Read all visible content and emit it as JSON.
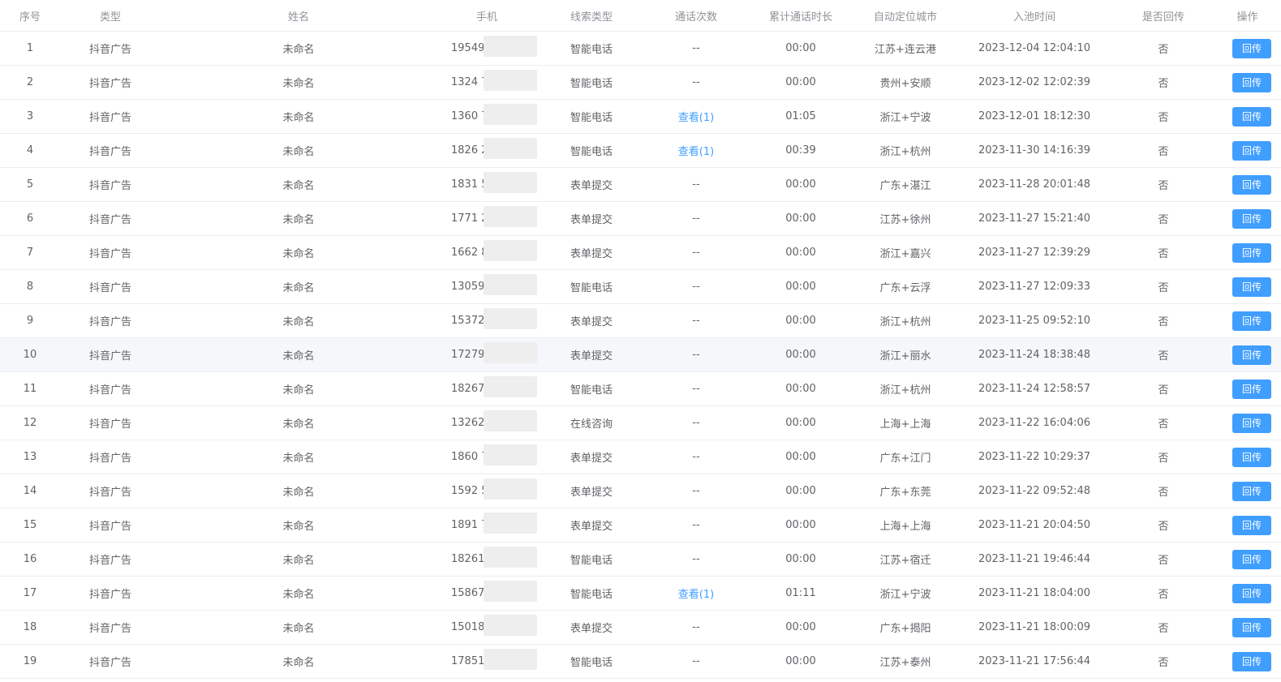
{
  "headers": {
    "seq": "序号",
    "type": "类型",
    "name": "姓名",
    "phone": "手机",
    "lead_type": "线索类型",
    "calls": "通话次数",
    "duration": "累计通话时长",
    "city": "自动定位城市",
    "time": "入池时间",
    "callback": "是否回传",
    "action": "操作"
  },
  "rows": [
    {
      "seq": "1",
      "type": "抖音广告",
      "name": "未命名",
      "phone": "19549",
      "lead_type": "智能电话",
      "calls": "--",
      "calls_link": false,
      "duration": "00:00",
      "city": "江苏+连云港",
      "time": "2023-12-04 12:04:10",
      "callback": "否",
      "action": "回传"
    },
    {
      "seq": "2",
      "type": "抖音广告",
      "name": "未命名",
      "phone": "1324          7",
      "lead_type": "智能电话",
      "calls": "--",
      "calls_link": false,
      "duration": "00:00",
      "city": "贵州+安顺",
      "time": "2023-12-02 12:02:39",
      "callback": "否",
      "action": "回传"
    },
    {
      "seq": "3",
      "type": "抖音广告",
      "name": "未命名",
      "phone": "1360          77",
      "lead_type": "智能电话",
      "calls": "查看(1)",
      "calls_link": true,
      "duration": "01:05",
      "city": "浙江+宁波",
      "time": "2023-12-01 18:12:30",
      "callback": "否",
      "action": "回传"
    },
    {
      "seq": "4",
      "type": "抖音广告",
      "name": "未命名",
      "phone": "1826          22",
      "lead_type": "智能电话",
      "calls": "查看(1)",
      "calls_link": true,
      "duration": "00:39",
      "city": "浙江+杭州",
      "time": "2023-11-30 14:16:39",
      "callback": "否",
      "action": "回传"
    },
    {
      "seq": "5",
      "type": "抖音广告",
      "name": "未命名",
      "phone": "1831          58",
      "lead_type": "表单提交",
      "calls": "--",
      "calls_link": false,
      "duration": "00:00",
      "city": "广东+湛江",
      "time": "2023-11-28 20:01:48",
      "callback": "否",
      "action": "回传"
    },
    {
      "seq": "6",
      "type": "抖音广告",
      "name": "未命名",
      "phone": "1771          23",
      "lead_type": "表单提交",
      "calls": "--",
      "calls_link": false,
      "duration": "00:00",
      "city": "江苏+徐州",
      "time": "2023-11-27 15:21:40",
      "callback": "否",
      "action": "回传"
    },
    {
      "seq": "7",
      "type": "抖音广告",
      "name": "未命名",
      "phone": "1662          8",
      "lead_type": "表单提交",
      "calls": "--",
      "calls_link": false,
      "duration": "00:00",
      "city": "浙江+嘉兴",
      "time": "2023-11-27 12:39:29",
      "callback": "否",
      "action": "回传"
    },
    {
      "seq": "8",
      "type": "抖音广告",
      "name": "未命名",
      "phone": "13059",
      "lead_type": "智能电话",
      "calls": "--",
      "calls_link": false,
      "duration": "00:00",
      "city": "广东+云浮",
      "time": "2023-11-27 12:09:33",
      "callback": "否",
      "action": "回传"
    },
    {
      "seq": "9",
      "type": "抖音广告",
      "name": "未命名",
      "phone": "153726",
      "lead_type": "表单提交",
      "calls": "--",
      "calls_link": false,
      "duration": "00:00",
      "city": "浙江+杭州",
      "time": "2023-11-25 09:52:10",
      "callback": "否",
      "action": "回传"
    },
    {
      "seq": "10",
      "type": "抖音广告",
      "name": "未命名",
      "phone": "172797",
      "lead_type": "表单提交",
      "calls": "--",
      "calls_link": false,
      "duration": "00:00",
      "city": "浙江+丽水",
      "time": "2023-11-24 18:38:48",
      "callback": "否",
      "action": "回传",
      "highlight": true
    },
    {
      "seq": "11",
      "type": "抖音广告",
      "name": "未命名",
      "phone": "18267",
      "lead_type": "智能电话",
      "calls": "--",
      "calls_link": false,
      "duration": "00:00",
      "city": "浙江+杭州",
      "time": "2023-11-24 12:58:57",
      "callback": "否",
      "action": "回传"
    },
    {
      "seq": "12",
      "type": "抖音广告",
      "name": "未命名",
      "phone": "13262",
      "lead_type": "在线咨询",
      "calls": "--",
      "calls_link": false,
      "duration": "00:00",
      "city": "上海+上海",
      "time": "2023-11-22 16:04:06",
      "callback": "否",
      "action": "回传"
    },
    {
      "seq": "13",
      "type": "抖音广告",
      "name": "未命名",
      "phone": "1860          7",
      "lead_type": "表单提交",
      "calls": "--",
      "calls_link": false,
      "duration": "00:00",
      "city": "广东+江门",
      "time": "2023-11-22 10:29:37",
      "callback": "否",
      "action": "回传"
    },
    {
      "seq": "14",
      "type": "抖音广告",
      "name": "未命名",
      "phone": "1592          5",
      "lead_type": "表单提交",
      "calls": "--",
      "calls_link": false,
      "duration": "00:00",
      "city": "广东+东莞",
      "time": "2023-11-22 09:52:48",
      "callback": "否",
      "action": "回传"
    },
    {
      "seq": "15",
      "type": "抖音广告",
      "name": "未命名",
      "phone": "1891          7",
      "lead_type": "表单提交",
      "calls": "--",
      "calls_link": false,
      "duration": "00:00",
      "city": "上海+上海",
      "time": "2023-11-21 20:04:50",
      "callback": "否",
      "action": "回传"
    },
    {
      "seq": "16",
      "type": "抖音广告",
      "name": "未命名",
      "phone": "18261",
      "lead_type": "智能电话",
      "calls": "--",
      "calls_link": false,
      "duration": "00:00",
      "city": "江苏+宿迁",
      "time": "2023-11-21 19:46:44",
      "callback": "否",
      "action": "回传"
    },
    {
      "seq": "17",
      "type": "抖音广告",
      "name": "未命名",
      "phone": "15867",
      "lead_type": "智能电话",
      "calls": "查看(1)",
      "calls_link": true,
      "duration": "01:11",
      "city": "浙江+宁波",
      "time": "2023-11-21 18:04:00",
      "callback": "否",
      "action": "回传"
    },
    {
      "seq": "18",
      "type": "抖音广告",
      "name": "未命名",
      "phone": "15018          9",
      "lead_type": "表单提交",
      "calls": "--",
      "calls_link": false,
      "duration": "00:00",
      "city": "广东+揭阳",
      "time": "2023-11-21 18:00:09",
      "callback": "否",
      "action": "回传"
    },
    {
      "seq": "19",
      "type": "抖音广告",
      "name": "未命名",
      "phone": "17851          0",
      "lead_type": "智能电话",
      "calls": "--",
      "calls_link": false,
      "duration": "00:00",
      "city": "江苏+泰州",
      "time": "2023-11-21 17:56:44",
      "callback": "否",
      "action": "回传"
    }
  ]
}
